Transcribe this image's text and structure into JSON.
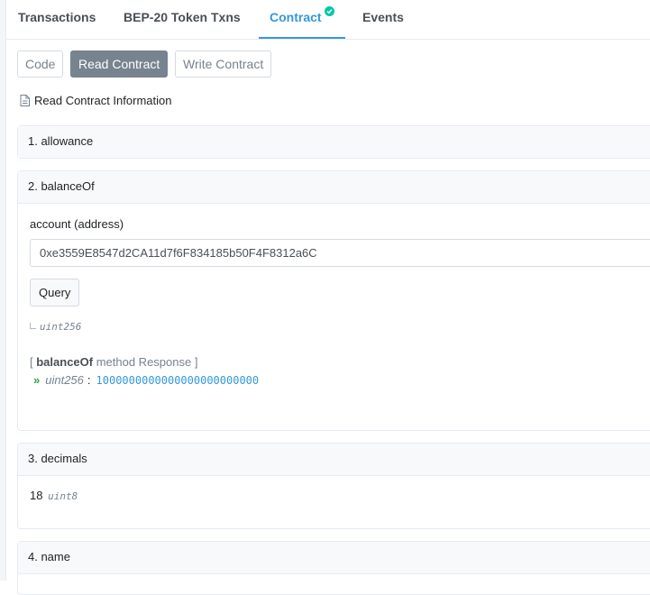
{
  "tabs": [
    {
      "label": "Transactions"
    },
    {
      "label": "BEP-20 Token Txns"
    },
    {
      "label": "Contract"
    },
    {
      "label": "Events"
    }
  ],
  "subtabs": {
    "code": "Code",
    "read": "Read Contract",
    "write": "Write Contract"
  },
  "info_label": "Read Contract Information",
  "functions": [
    {
      "title": "1. allowance"
    },
    {
      "title": "2. balanceOf",
      "input_label": "account (address)",
      "input_value": "0xe3559E8547d2CA11d7f6F834185b50F4F8312a6C",
      "query_label": "Query",
      "output_type": "uint256",
      "response_open": "[ ",
      "response_method": "balanceOf",
      "response_rest": " method Response ]",
      "response_type": "uint256",
      "response_value": "1000000000000000000000000"
    },
    {
      "title": "3. decimals",
      "value": "18",
      "value_type": "uint8"
    },
    {
      "title": "4. name"
    }
  ],
  "colors": {
    "accent": "#3498db",
    "verified": "#00c9a7",
    "success": "#28a745"
  },
  "icons": {
    "verified": "check-circle-icon",
    "info": "document-icon",
    "response": "double-chevron-right-icon"
  }
}
